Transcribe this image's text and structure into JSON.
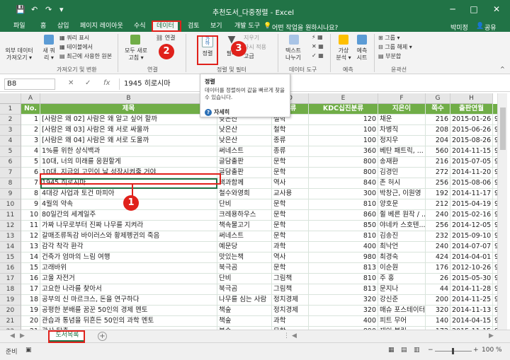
{
  "window": {
    "title": "추천도서_다중정렬 - Excel",
    "controls": [
      "─",
      "□",
      "✕"
    ],
    "qa_icons": [
      "save-icon",
      "undo-icon",
      "redo-icon",
      "customize-icon"
    ]
  },
  "tabs": [
    "파일",
    "홈",
    "삽입",
    "페이지 레이아웃",
    "수식",
    "데이터",
    "검토",
    "보기",
    "개발 도구"
  ],
  "active_tab": "데이터",
  "tell_me": "어떤 작업을 원하시나요?",
  "user": "박미정",
  "share": "공유",
  "ribbon": {
    "get_external": "외부 데이터\n가져오기 ▾",
    "new_query": "새 쿼\n리 ▾",
    "show_queries": "쿼리 표시",
    "from_table": "테이블에서",
    "recent_sources": "최근에 사용한 원본",
    "refresh_all": "모두 새로\n고침 ▾",
    "connections": "연결",
    "sort": "정렬",
    "filter": "필터",
    "clear": "지우기",
    "reapply": "다시 적용",
    "advanced": "고급",
    "text_to_columns": "텍스트\n나누기",
    "whatif": "가상\n분석 ▾",
    "forecast": "예측\n시트",
    "group": "그룹 ▾",
    "ungroup": "그룹 해제 ▾",
    "subtotal": "부분합",
    "groups": [
      "가져오기 및 변환",
      "연결",
      "정렬 및 필터",
      "데이터 도구",
      "예측",
      "윤곽선"
    ]
  },
  "tooltip": {
    "title": "정렬",
    "body": "데이터를 정렬하여 값을 빠르게 찾을 수 있습니다.",
    "more": "자세히"
  },
  "formula_bar": {
    "name_box": "B8",
    "fx": "fx",
    "value": "1945 히로시마"
  },
  "columns": [
    "A",
    "B",
    "C",
    "D",
    "E",
    "F",
    "G",
    "H"
  ],
  "headers": [
    "No.",
    "제목",
    "출판사",
    "분류",
    "KDC십진분류",
    "지은이",
    "쪽수",
    "출판연월",
    ""
  ],
  "rows": [
    [
      "1",
      "[사람은 왜 02] 사람은 왜 알고 싶어 할까",
      "낮은산",
      "철학",
      "120",
      "채운",
      "216",
      "2015-01-26",
      "97"
    ],
    [
      "2",
      "[사람은 왜 03] 사람은 왜 서로 싸울까",
      "낮은산",
      "철학",
      "100",
      "차병직",
      "208",
      "2015-06-26",
      "97"
    ],
    [
      "3",
      "[사람은 왜 04] 사람은 왜 서로 도울까",
      "낮은산",
      "종류",
      "100",
      "정지우",
      "204",
      "2015-08-26",
      "97"
    ],
    [
      "4",
      "1%를 위한 상식백과",
      "써네스트",
      "종류",
      "360",
      "베탄 패트릭, ...",
      "560",
      "2014-11-15",
      "97"
    ],
    [
      "5",
      "10대, 너의 미래를 응원할게",
      "글담출판",
      "문학",
      "800",
      "송재환",
      "216",
      "2015-07-05",
      "97"
    ],
    [
      "6",
      "10대, 지금의 고민이 날 성장시켜줄 거야",
      "글담출판",
      "문학",
      "800",
      "김경민",
      "272",
      "2014-11-20",
      "97"
    ],
    [
      "7",
      "1945 히로시마",
      "책과함께",
      "역사",
      "840",
      "존 허시",
      "256",
      "2015-08-06",
      "97"
    ],
    [
      "8",
      "4대강 사업과 토건 마피아",
      "철수와영희",
      "교사용",
      "300",
      "박창근, 이원영",
      "192",
      "2014-11-17",
      "97"
    ],
    [
      "9",
      "4월의 약속",
      "단비",
      "문학",
      "810",
      "양호문",
      "212",
      "2015-04-19",
      "97"
    ],
    [
      "10",
      "80일간의 세계일주",
      "크레용하우스",
      "문학",
      "860",
      "쥘 베른 원작 / ...",
      "240",
      "2015-02-16",
      "97"
    ],
    [
      "11",
      "가짜 나무로부터 진짜 나무를 지켜라",
      "책속물고기",
      "문학",
      "850",
      "야네카 스호텐...",
      "256",
      "2014-12-05",
      "97"
    ],
    [
      "12",
      "갈매조류독감 바이러스와 황제펭귄의 죽음",
      "써네스트",
      "문학",
      "810",
      "김송진",
      "232",
      "2015-09-10",
      "97"
    ],
    [
      "13",
      "감각 착각 환각",
      "예문당",
      "과학",
      "400",
      "최낙언",
      "240",
      "2014-07-07",
      "97"
    ],
    [
      "14",
      "건축가 엄마의 느림 여행",
      "맛있는책",
      "역사",
      "980",
      "최경숙",
      "424",
      "2014-04-01",
      "97"
    ],
    [
      "15",
      "고래바위",
      "북극곰",
      "문학",
      "813",
      "이순원",
      "176",
      "2012-10-26",
      "97"
    ],
    [
      "16",
      "고울 자전거",
      "단비",
      "그림책",
      "810",
      "주 홍",
      "26",
      "2015-05-30",
      "97"
    ],
    [
      "17",
      "고요한 나라를 찾아서",
      "북극곰",
      "그림책",
      "813",
      "문지나",
      "44",
      "2014-11-28",
      "97"
    ],
    [
      "18",
      "공부의 신 마르크스, 돈을 연구하다",
      "나무를 심는 사람",
      "정치경제",
      "320",
      "강신준",
      "200",
      "2014-11-25",
      "97"
    ],
    [
      "19",
      "공평한 분배를 꿈꾼 50인의 경제 멘토",
      "책숲",
      "정치경제",
      "320",
      "매슈 포스테이터",
      "320",
      "2014-11-13",
      "97"
    ],
    [
      "20",
      "관습과 통념을 뒤흔든 50인의 과학 멘토",
      "책숲",
      "과학",
      "400",
      "피트 무어",
      "140",
      "2014-04-15",
      "97"
    ],
    [
      "21",
      "광산 탈출",
      "봄숲",
      "문학",
      "890",
      "제인 볼링",
      "172",
      "2015-11-15",
      "97"
    ],
    [
      "22",
      "괜찮아, 방학이야!",
      "와이스쿨",
      "문학",
      "810",
      "김해저",
      "240",
      "2014-08-08",
      "97"
    ]
  ],
  "sheet_tab": "도서목록",
  "status": {
    "ready": "준비",
    "zoom": "100 %"
  },
  "annotations": [
    "1",
    "2",
    "3"
  ]
}
